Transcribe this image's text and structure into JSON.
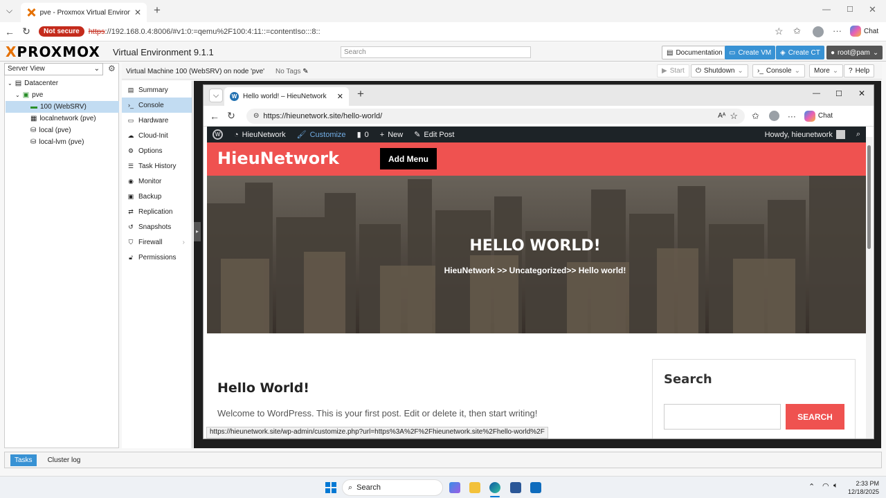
{
  "browser": {
    "tab_title": "pve - Proxmox Virtual Environment",
    "not_secure": "Not secure",
    "url_scheme": "https",
    "url_rest": "://192.168.0.4:8006/#v1:0:=qemu%2F100:4:11::=contentIso:::8::",
    "chat_label": "Chat"
  },
  "header": {
    "logo": "PROXMOX",
    "version": "Virtual Environment 9.1.1",
    "search_placeholder": "Search",
    "documentation": "Documentation",
    "create_vm": "Create VM",
    "create_ct": "Create CT",
    "user": "root@pam"
  },
  "tree": {
    "view": "Server View",
    "items": [
      "Datacenter",
      "pve",
      "100 (WebSRV)",
      "localnetwork (pve)",
      "local (pve)",
      "local-lvm (pve)"
    ]
  },
  "vm_toolbar": {
    "title": "Virtual Machine 100 (WebSRV) on node 'pve'",
    "tags": "No Tags",
    "start": "Start",
    "shutdown": "Shutdown",
    "console": "Console",
    "more": "More",
    "help": "Help"
  },
  "menu": [
    "Summary",
    "Console",
    "Hardware",
    "Cloud-Init",
    "Options",
    "Task History",
    "Monitor",
    "Backup",
    "Replication",
    "Snapshots",
    "Firewall",
    "Permissions"
  ],
  "inner": {
    "tab_title": "Hello world! – HieuNetwork",
    "url": "https://hieunetwork.site/hello-world/",
    "chat": "Chat",
    "wp_bar": {
      "site": "HieuNetwork",
      "customize": "Customize",
      "comments": "0",
      "new": "New",
      "edit": "Edit Post",
      "howdy": "Howdy, hieunetwork"
    },
    "site_title": "HieuNetwork",
    "add_menu": "Add Menu",
    "hero_title": "HELLO WORLD!",
    "hero_crumb": "HieuNetwork >> Uncategorized>> Hello world!",
    "post_title": "Hello World!",
    "post_text": "Welcome to WordPress. This is your first post. Edit or delete it, then start writing!",
    "widget_title": "Search",
    "widget_button": "SEARCH",
    "status_url": "https://hieunetwork.site/wp-admin/customize.php?url=https%3A%2F%2Fhieunetwork.site%2Fhello-world%2F"
  },
  "bottom": {
    "tasks": "Tasks",
    "cluster_log": "Cluster log"
  },
  "taskbar": {
    "search": "Search",
    "time": "2:33 PM",
    "date": "12/18/2025"
  }
}
